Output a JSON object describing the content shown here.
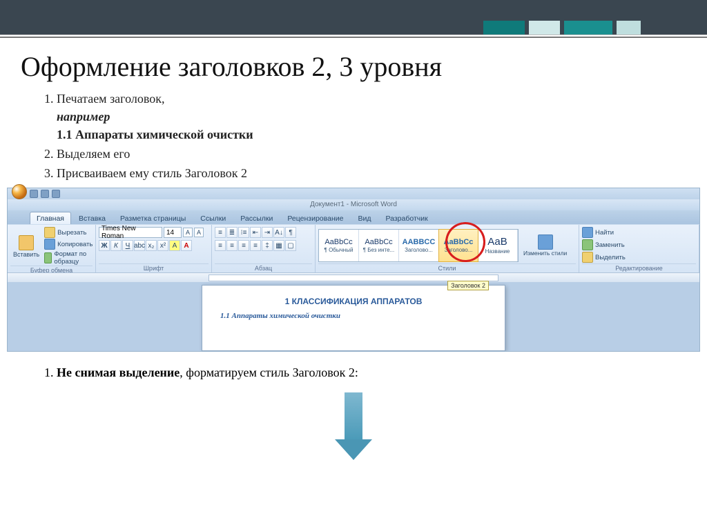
{
  "slide": {
    "title": "Оформление заголовков 2, 3 уровня",
    "steps": {
      "s1_a": "Печатаем заголовок,",
      "s1_b": "например",
      "s1_c": "1.1 Аппараты химической очистки",
      "s2": "Выделяем его",
      "s3": "Присваиваем ему стиль Заголовок 2"
    },
    "bottom_prefix": "Не снимая выделение",
    "bottom_rest": ",  форматируем стиль Заголовок 2:"
  },
  "word": {
    "title": "Документ1 - Microsoft Word",
    "tabs": [
      "Главная",
      "Вставка",
      "Разметка страницы",
      "Ссылки",
      "Рассылки",
      "Рецензирование",
      "Вид",
      "Разработчик"
    ],
    "active_tab": 0,
    "clipboard": {
      "paste": "Вставить",
      "cut": "Вырезать",
      "copy": "Копировать",
      "painter": "Формат по образцу",
      "group": "Буфер обмена"
    },
    "font": {
      "name": "Times New Roman",
      "size": "14",
      "group": "Шрифт"
    },
    "paragraph": {
      "group": "Абзац"
    },
    "styles": {
      "group": "Стили",
      "items": [
        {
          "preview": "AaBbCc",
          "name": "¶ Обычный"
        },
        {
          "preview": "AaBbCc",
          "name": "¶ Без инте..."
        },
        {
          "preview": "AABBCC",
          "name": "Заголово..."
        },
        {
          "preview": "AaBbCc",
          "name": "Заголово..."
        },
        {
          "preview": "АаВ",
          "name": "Название"
        }
      ],
      "change": "Изменить стили"
    },
    "editing": {
      "find": "Найти",
      "replace": "Заменить",
      "select": "Выделить",
      "group": "Редактирование"
    },
    "ruler_tooltip": "Заголовок 2",
    "page": {
      "heading1": "1 КЛАССИФИКАЦИЯ АППАРАТОВ",
      "heading2": "1.1 Аппараты химической очистки"
    }
  }
}
